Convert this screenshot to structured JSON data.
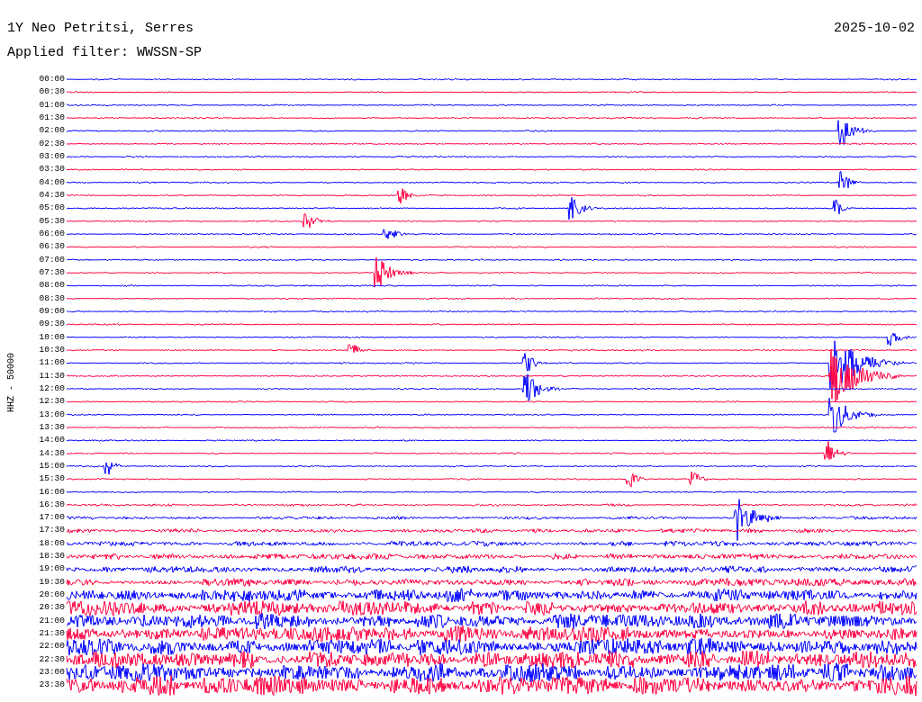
{
  "header": {
    "station": "1Y Neo Petritsi, Serres",
    "date": "2025-10-02",
    "filter": "Applied filter: WWSSN-SP"
  },
  "plot": {
    "axis_label": "HHZ - 50000",
    "traces": [
      {
        "label": "00:00",
        "color": "#0000ff"
      },
      {
        "label": "00:30",
        "color": "#ff0040"
      },
      {
        "label": "01:00",
        "color": "#0000ff"
      },
      {
        "label": "01:30",
        "color": "#ff0040"
      },
      {
        "label": "02:00",
        "color": "#0000ff"
      },
      {
        "label": "02:30",
        "color": "#ff0040"
      },
      {
        "label": "03:00",
        "color": "#0000ff"
      },
      {
        "label": "03:30",
        "color": "#ff0040"
      },
      {
        "label": "04:00",
        "color": "#0000ff"
      },
      {
        "label": "04:30",
        "color": "#ff0040"
      },
      {
        "label": "05:00",
        "color": "#0000ff"
      },
      {
        "label": "05:30",
        "color": "#ff0040"
      },
      {
        "label": "06:00",
        "color": "#0000ff"
      },
      {
        "label": "06:30",
        "color": "#ff0040"
      },
      {
        "label": "07:00",
        "color": "#0000ff"
      },
      {
        "label": "07:30",
        "color": "#ff0040"
      },
      {
        "label": "08:00",
        "color": "#0000ff"
      },
      {
        "label": "08:30",
        "color": "#ff0040"
      },
      {
        "label": "09:00",
        "color": "#0000ff"
      },
      {
        "label": "09:30",
        "color": "#ff0040"
      },
      {
        "label": "10:00",
        "color": "#0000ff"
      },
      {
        "label": "10:30",
        "color": "#ff0040"
      },
      {
        "label": "11:00",
        "color": "#0000ff"
      },
      {
        "label": "11:30",
        "color": "#ff0040"
      },
      {
        "label": "12:00",
        "color": "#0000ff"
      },
      {
        "label": "12:30",
        "color": "#ff0040"
      },
      {
        "label": "13:00",
        "color": "#0000ff"
      },
      {
        "label": "13:30",
        "color": "#ff0040"
      },
      {
        "label": "14:00",
        "color": "#0000ff"
      },
      {
        "label": "14:30",
        "color": "#ff0040"
      },
      {
        "label": "15:00",
        "color": "#0000ff"
      },
      {
        "label": "15:30",
        "color": "#ff0040"
      },
      {
        "label": "16:00",
        "color": "#0000ff"
      },
      {
        "label": "16:30",
        "color": "#ff0040"
      },
      {
        "label": "17:00",
        "color": "#0000ff"
      },
      {
        "label": "17:30",
        "color": "#ff0040"
      },
      {
        "label": "18:00",
        "color": "#0000ff"
      },
      {
        "label": "18:30",
        "color": "#ff0040"
      },
      {
        "label": "19:00",
        "color": "#0000ff"
      },
      {
        "label": "19:30",
        "color": "#ff0040"
      },
      {
        "label": "20:00",
        "color": "#0000ff"
      },
      {
        "label": "20:30",
        "color": "#ff0040"
      },
      {
        "label": "21:00",
        "color": "#0000ff"
      },
      {
        "label": "21:30",
        "color": "#ff0040"
      },
      {
        "label": "22:00",
        "color": "#0000ff"
      },
      {
        "label": "22:30",
        "color": "#ff0040"
      },
      {
        "label": "23:00",
        "color": "#0000ff"
      },
      {
        "label": "23:30",
        "color": "#ff0040"
      }
    ]
  }
}
